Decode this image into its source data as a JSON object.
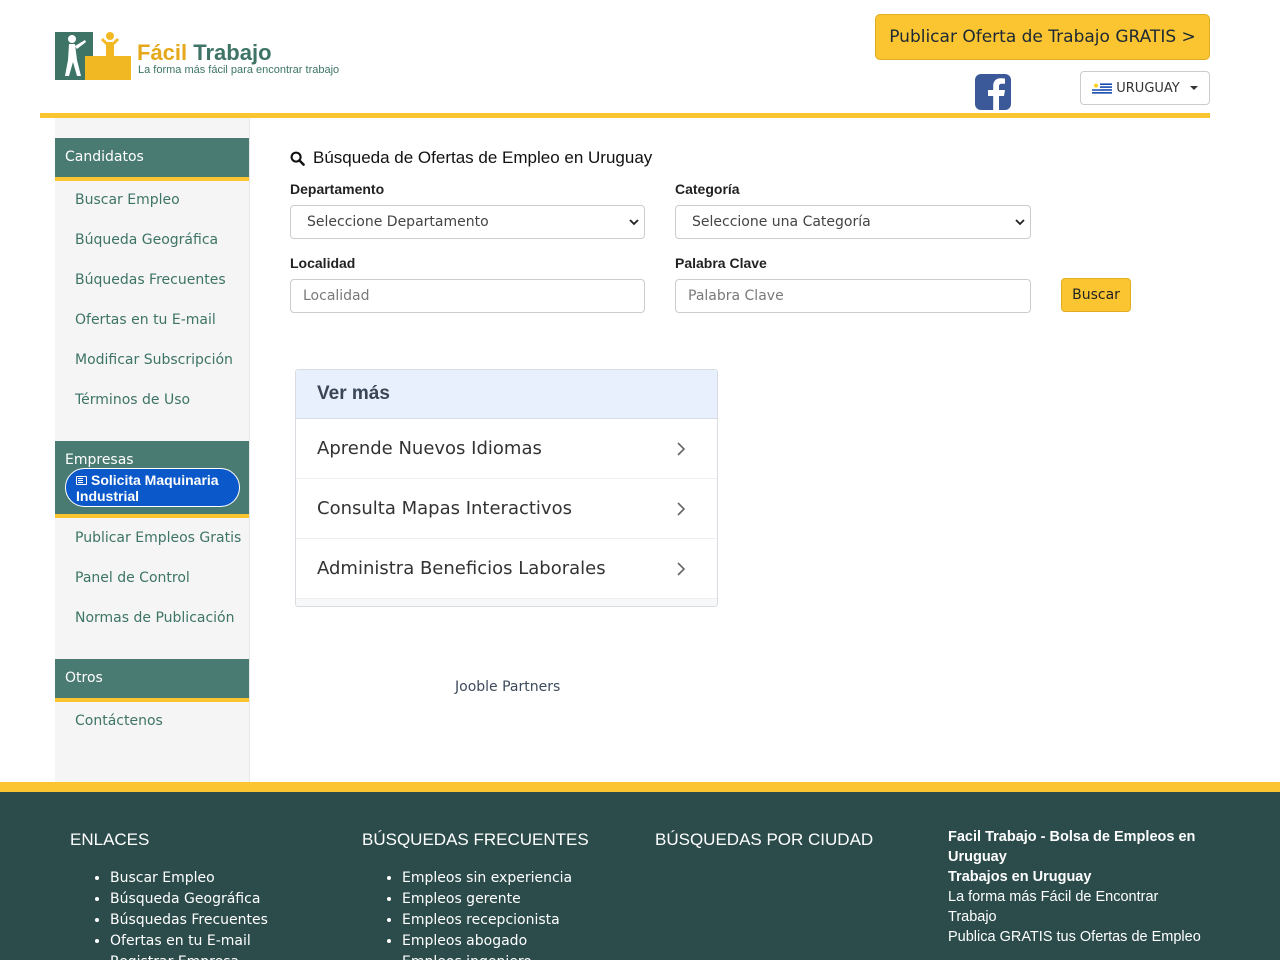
{
  "header": {
    "logo_word1": "Fácil",
    "logo_word2": "Trabajo",
    "logo_tagline": "La forma más fácil para encontrar trabajo",
    "publish_label": "Publicar Oferta de Trabajo GRATIS >",
    "country_label": "URUGUAY",
    "social_icon": "facebook-icon",
    "colors": {
      "accent": "#fbc531",
      "brand_green": "#3d7466"
    }
  },
  "sidebar": {
    "candidatos": {
      "title": "Candidatos",
      "items": [
        "Buscar Empleo",
        "Búqueda Geográfica",
        "Búquedas Frecuentes",
        "Ofertas en tu E-mail",
        "Modificar Subscripción",
        "Términos de Uso"
      ]
    },
    "empresas": {
      "title": "Empresas",
      "ad_label": "Solicita Maquinaria Industrial",
      "items": [
        "Publicar Empleos Gratis",
        "Panel de Control",
        "Normas de Publicación"
      ]
    },
    "otros": {
      "title": "Otros",
      "items": [
        "Contáctenos"
      ]
    }
  },
  "search": {
    "title": "Búsqueda de Ofertas de Empleo en Uruguay",
    "departamento_label": "Departamento",
    "departamento_value": "Seleccione Departamento",
    "categoria_label": "Categoría",
    "categoria_value": "Seleccione una Categoría",
    "localidad_label": "Localidad",
    "localidad_placeholder": "Localidad",
    "palabra_label": "Palabra Clave",
    "palabra_placeholder": "Palabra Clave",
    "button_label": "Buscar"
  },
  "ver_mas": {
    "title": "Ver más",
    "items": [
      "Aprende Nuevos Idiomas",
      "Consulta Mapas Interactivos",
      "Administra Beneficios Laborales"
    ]
  },
  "jooble_label": "Jooble Partners",
  "footer": {
    "enlaces": {
      "title": "ENLACES",
      "items": [
        "Buscar Empleo",
        "Búsqueda Geográfica",
        "Búsquedas Frecuentes",
        "Ofertas en tu E-mail",
        "Registrar Empresa"
      ]
    },
    "frecuentes": {
      "title": "BÚSQUEDAS FRECUENTES",
      "items": [
        "Empleos sin experiencia",
        "Empleos gerente",
        "Empleos recepcionista",
        "Empleos abogado",
        "Empleos ingeniero"
      ]
    },
    "ciudad": {
      "title": "BÚSQUEDAS POR CIUDAD"
    },
    "about": {
      "line1": "Facil Trabajo - Bolsa de Empleos en Uruguay",
      "line2": "Trabajos en Uruguay",
      "line3": "La forma más Fácil de Encontrar Trabajo",
      "line4": "Publica GRATIS tus Ofertas de Empleo"
    }
  }
}
